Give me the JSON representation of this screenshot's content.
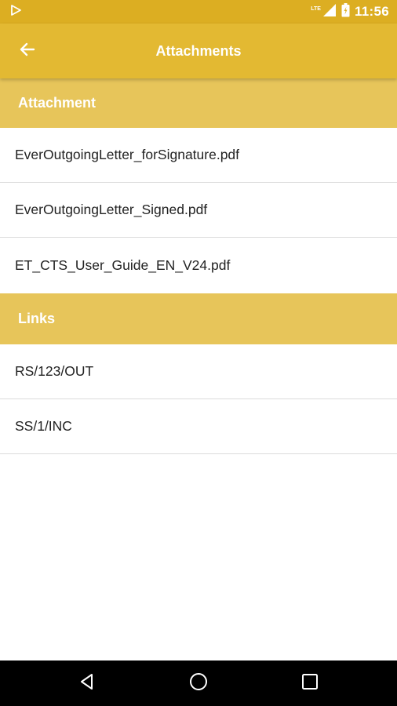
{
  "status_bar": {
    "network_label": "LTE",
    "time": "11:56",
    "icons": [
      "play-store-icon",
      "signal-icon",
      "battery-icon"
    ]
  },
  "app_bar": {
    "title": "Attachments",
    "back_icon": "arrow-left-icon"
  },
  "sections": {
    "attachment": {
      "header": "Attachment",
      "items": [
        "EverOutgoingLetter_forSignature.pdf",
        "EverOutgoingLetter_Signed.pdf",
        "ET_CTS_User_Guide_EN_V24.pdf"
      ]
    },
    "links": {
      "header": "Links",
      "items": [
        "RS/123/OUT",
        "SS/1/INC"
      ]
    }
  },
  "nav_bar": {
    "icons": [
      "back-triangle-icon",
      "home-circle-icon",
      "recents-square-icon"
    ]
  },
  "colors": {
    "status_bar": "#dcae22",
    "app_bar": "#e3b932",
    "section_header": "#e7c55a",
    "list_text": "#222222",
    "divider": "#dcdcdc"
  }
}
